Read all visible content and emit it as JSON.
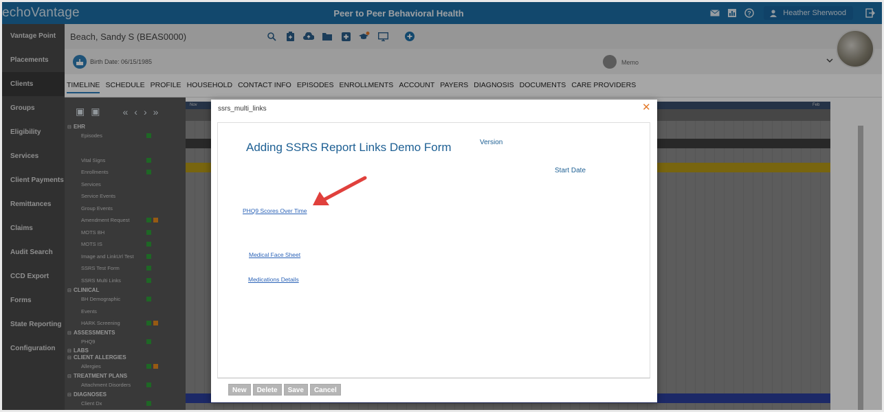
{
  "app": {
    "logo": "echoVantage",
    "organization": "Peer to Peer Behavioral Health",
    "user": "Heather Sherwood"
  },
  "sidebar": {
    "items": [
      {
        "label": "Vantage Point"
      },
      {
        "label": "Placements"
      },
      {
        "label": "Clients"
      },
      {
        "label": "Groups"
      },
      {
        "label": "Eligibility"
      },
      {
        "label": "Services"
      },
      {
        "label": "Client Payments"
      },
      {
        "label": "Remittances"
      },
      {
        "label": "Claims"
      },
      {
        "label": "Audit Search"
      },
      {
        "label": "CCD Export"
      },
      {
        "label": "Forms"
      },
      {
        "label": "State Reporting"
      },
      {
        "label": "Configuration"
      }
    ]
  },
  "client": {
    "name": "Beach, Sandy S (BEAS0000)",
    "birth": "Birth Date: 06/15/1985",
    "memo": "Memo"
  },
  "tabs": [
    "TIMELINE",
    "SCHEDULE",
    "PROFILE",
    "HOUSEHOLD",
    "CONTACT INFO",
    "EPISODES",
    "ENROLLMENTS",
    "ACCOUNT",
    "PAYERS",
    "DIAGNOSIS",
    "DOCUMENTS",
    "CARE PROVIDERS"
  ],
  "timeline": {
    "rows": [
      {
        "label": "EHR",
        "type": "section"
      },
      {
        "label": "Episodes",
        "type": "item"
      },
      {
        "label": "Vital Signs",
        "type": "item"
      },
      {
        "label": "Enrollments",
        "type": "item"
      },
      {
        "label": "Services",
        "type": "item"
      },
      {
        "label": "Service Events",
        "type": "item"
      },
      {
        "label": "Group Events",
        "type": "item"
      },
      {
        "label": "Amendment Request",
        "type": "item"
      },
      {
        "label": "MOTS BH",
        "type": "item"
      },
      {
        "label": "MOTS IS",
        "type": "item"
      },
      {
        "label": "Image and LinkUrl Test",
        "type": "item"
      },
      {
        "label": "SSRS Test Form",
        "type": "item"
      },
      {
        "label": "SSRS Multi Links",
        "type": "item"
      },
      {
        "label": "CLINICAL",
        "type": "section"
      },
      {
        "label": "BH Demographic",
        "type": "item"
      },
      {
        "label": "Events",
        "type": "item"
      },
      {
        "label": "HARK Screening",
        "type": "item"
      },
      {
        "label": "ASSESSMENTS",
        "type": "section"
      },
      {
        "label": "PHQ9",
        "type": "item"
      },
      {
        "label": "LABS",
        "type": "section"
      },
      {
        "label": "CLIENT ALLERGIES",
        "type": "section"
      },
      {
        "label": "Allergies",
        "type": "item"
      },
      {
        "label": "TREATMENT PLANS",
        "type": "section"
      },
      {
        "label": "Attachment Disorders",
        "type": "item"
      },
      {
        "label": "DIAGNOSES",
        "type": "section"
      },
      {
        "label": "Client Dx",
        "type": "item"
      }
    ],
    "months": [
      "Nov",
      "Feb"
    ]
  },
  "dialog": {
    "title": "ssrs_multi_links",
    "form_title": "Adding SSRS Report Links Demo Form",
    "version_label": "Version",
    "start_date_label": "Start Date",
    "links": {
      "phq9": "PHQ9 Scores Over Time",
      "face_sheet": "Medical Face Sheet",
      "medications": "Medications Details"
    },
    "buttons": {
      "new": "New",
      "delete": "Delete",
      "save": "Save",
      "cancel": "Cancel"
    }
  },
  "colors": {
    "brand": "#1d6fa8",
    "sidebar": "#4b4b4b",
    "accent_orange": "#e37a2b",
    "arrow": "#e0403c"
  }
}
